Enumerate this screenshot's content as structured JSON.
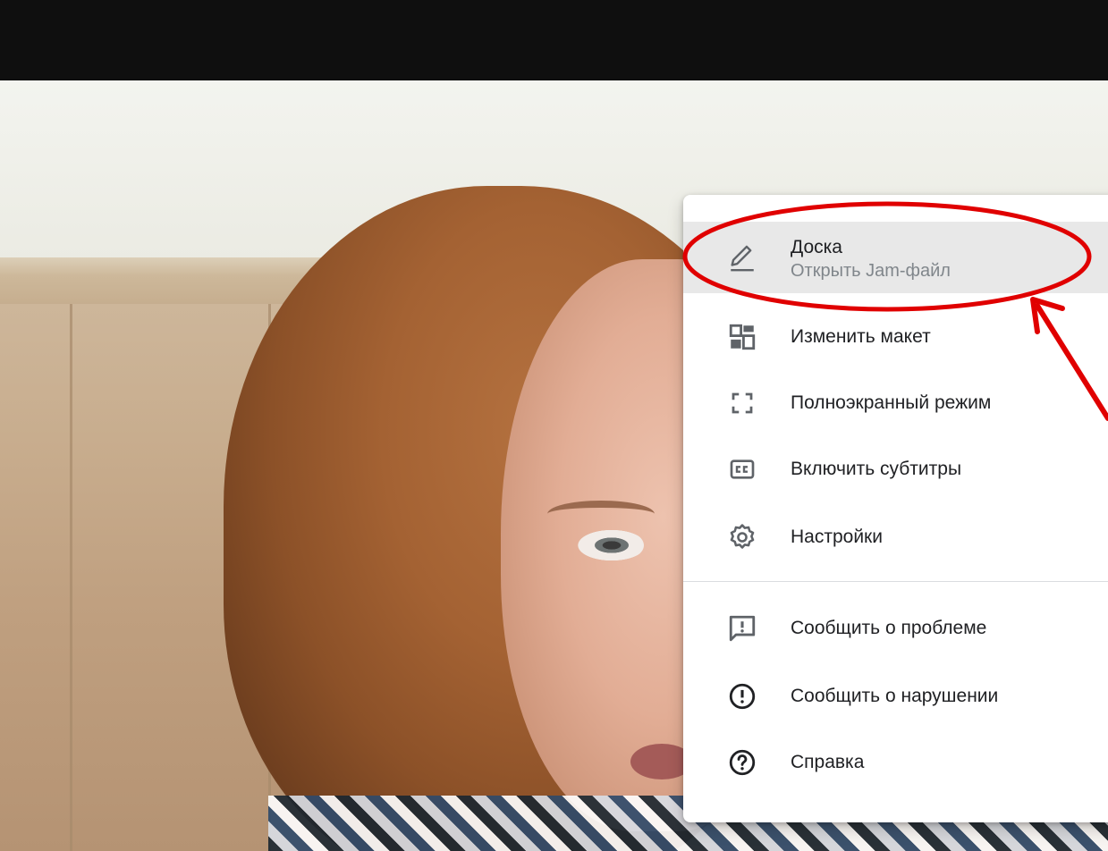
{
  "menu": {
    "items": [
      {
        "label": "Доска",
        "sublabel": "Открыть Jam-файл",
        "icon": "pen-icon"
      },
      {
        "label": "Изменить макет",
        "icon": "layout-icon"
      },
      {
        "label": "Полноэкранный режим",
        "icon": "fullscreen-icon"
      },
      {
        "label": "Включить субтитры",
        "icon": "closed-captions-icon"
      },
      {
        "label": "Настройки",
        "icon": "gear-icon"
      },
      {
        "label": "Сообщить о проблеме",
        "icon": "feedback-icon"
      },
      {
        "label": "Сообщить о нарушении",
        "icon": "report-abuse-icon"
      },
      {
        "label": "Справка",
        "icon": "help-icon"
      }
    ]
  },
  "colors": {
    "annotation_red": "#e00000",
    "icon_gray": "#5f6368",
    "highlight_bg": "#e8e8e8"
  }
}
